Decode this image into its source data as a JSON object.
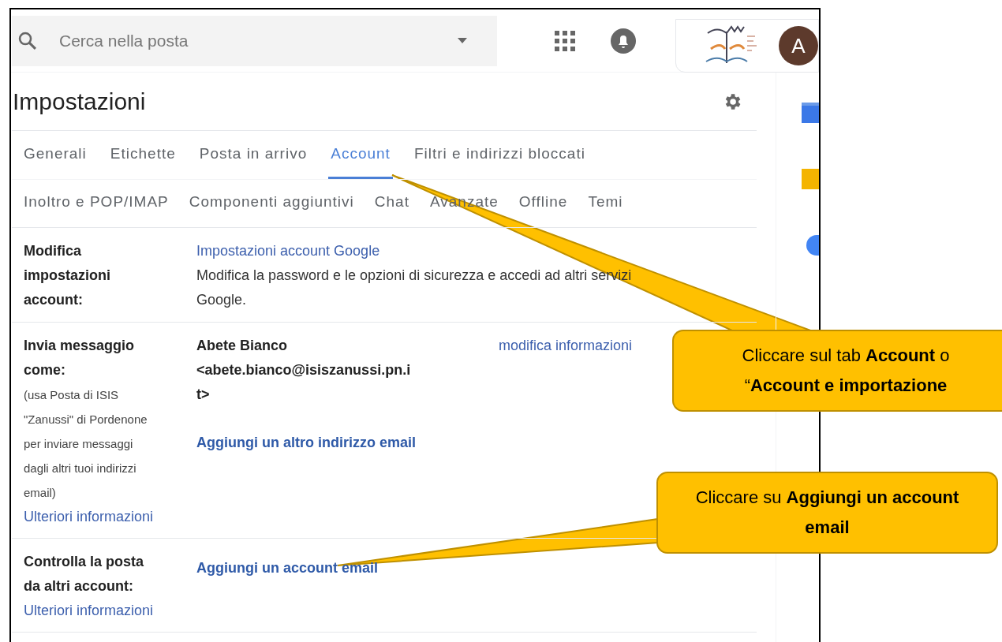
{
  "search": {
    "placeholder": "Cerca nella posta"
  },
  "account": {
    "avatar_letter": "A"
  },
  "title": "Impostazioni",
  "tab_rows": [
    {
      "tabs": [
        {
          "label": "Generali",
          "selected": false
        },
        {
          "label": "Etichette",
          "selected": false
        },
        {
          "label": "Posta in arrivo",
          "selected": false
        },
        {
          "label": "Account",
          "selected": true
        },
        {
          "label": "Filtri e indirizzi bloccati",
          "selected": false
        }
      ]
    },
    {
      "tabs": [
        {
          "label": "Inoltro e POP/IMAP",
          "selected": false
        },
        {
          "label": "Componenti aggiuntivi",
          "selected": false
        },
        {
          "label": "Chat",
          "selected": false
        },
        {
          "label": "Avanzate",
          "selected": false
        },
        {
          "label": "Offline",
          "selected": false
        },
        {
          "label": "Temi",
          "selected": false
        }
      ]
    }
  ],
  "sections": [
    {
      "label": "Modifica impostazioni account:",
      "items": [
        {
          "kind": "link",
          "text": "Impostazioni account Google"
        },
        {
          "kind": "text",
          "text": "Modifica la password e le opzioni di sicurezza e accedi ad altri servizi Google."
        }
      ]
    },
    {
      "label": "Invia messaggio come:",
      "label_items": [
        {
          "kind": "note",
          "text": "(usa Posta di ISIS \"Zanussi\" di Pordenone per inviare messaggi dagli altri tuoi indirizzi email)"
        },
        {
          "kind": "link",
          "text": "Ulteriori informazioni"
        }
      ],
      "items": [
        {
          "kind": "identity",
          "name": "Abete Bianco",
          "email": "<abete.bianco@isiszanussi.pn.it>",
          "action": "modifica informazioni"
        },
        {
          "kind": "action",
          "text": "Aggiungi un altro indirizzo email"
        }
      ]
    },
    {
      "label": "Controlla la posta da altri account:",
      "label_items": [
        {
          "kind": "link",
          "text": "Ulteriori informazioni"
        }
      ],
      "items": [
        {
          "kind": "action",
          "text": "Aggiungi un account email"
        }
      ]
    }
  ],
  "callouts": [
    {
      "text": "Cliccare sul tab **Account** o “**Account e importazione**"
    },
    {
      "text": "Cliccare su **Aggiungi un account email**"
    }
  ]
}
